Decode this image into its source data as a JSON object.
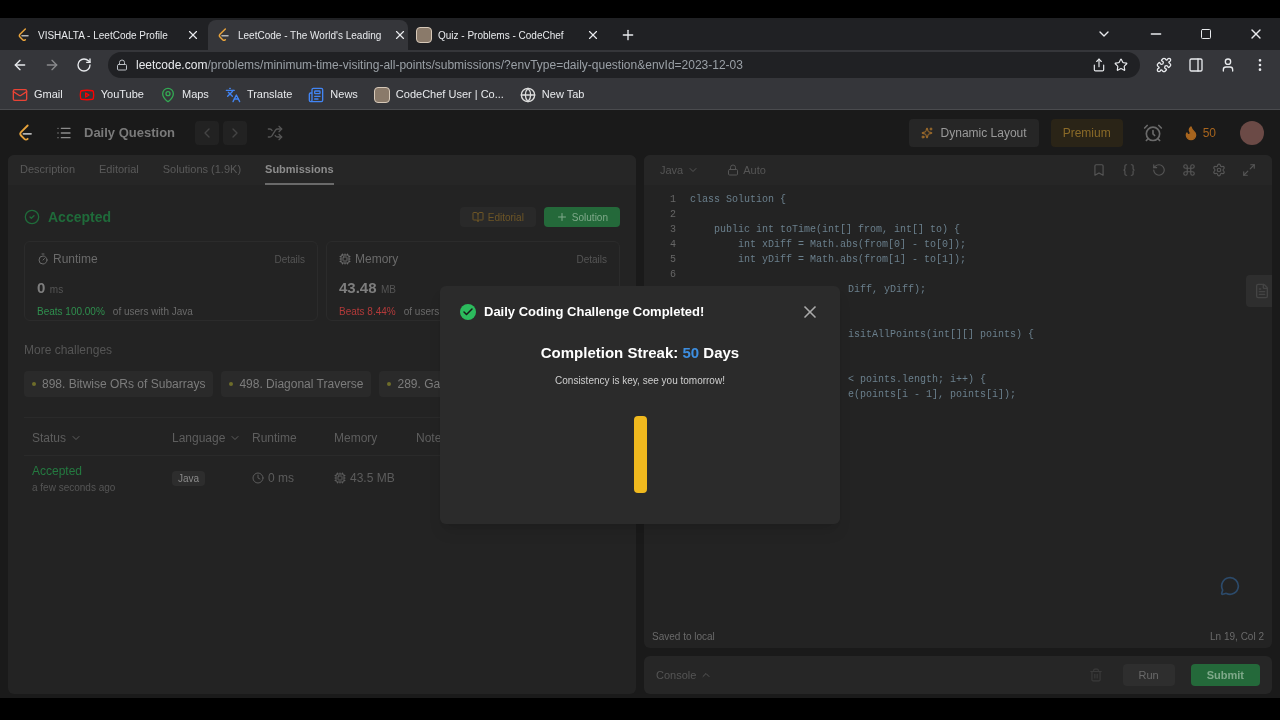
{
  "browser": {
    "tabs": [
      {
        "title": "VISHALTA - LeetCode Profile",
        "selected": false
      },
      {
        "title": "LeetCode - The World's Leading",
        "selected": true
      },
      {
        "title": "Quiz - Problems - CodeChef",
        "selected": false
      }
    ],
    "url_host": "leetcode.com",
    "url_path": "/problems/minimum-time-visiting-all-points/submissions/?envType=daily-question&envId=2023-12-03",
    "bookmarks": [
      {
        "label": "Gmail"
      },
      {
        "label": "YouTube"
      },
      {
        "label": "Maps"
      },
      {
        "label": "Translate"
      },
      {
        "label": "News"
      },
      {
        "label": "CodeChef User | Co..."
      },
      {
        "label": "New Tab"
      }
    ]
  },
  "header": {
    "title": "Daily Question",
    "layout_button": "Dynamic Layout",
    "premium_button": "Premium",
    "streak": "50"
  },
  "left_tabs": [
    {
      "label": "Description",
      "selected": false
    },
    {
      "label": "Editorial",
      "selected": false
    },
    {
      "label": "Solutions (1.9K)",
      "selected": false
    },
    {
      "label": "Submissions",
      "selected": true
    }
  ],
  "result": {
    "status": "Accepted",
    "editorial_button": "Editorial",
    "solution_button": "Solution"
  },
  "stats": [
    {
      "kind": "runtime",
      "label": "Runtime",
      "details": "Details",
      "value": "0",
      "unit": "ms",
      "beats": "Beats 100.00%",
      "color": "#2f8f4e",
      "note": "of users with Java"
    },
    {
      "kind": "memory",
      "label": "Memory",
      "details": "Details",
      "value": "43.48",
      "unit": "MB",
      "beats": "Beats 8.44%",
      "color": "#b33a3a",
      "note": "of users"
    }
  ],
  "more_challenges": {
    "title": "More challenges",
    "items": [
      "898. Bitwise ORs of Subarrays",
      "498. Diagonal Traverse",
      "289. Ga"
    ]
  },
  "table": {
    "columns": [
      {
        "label": "Status",
        "sortable": true
      },
      {
        "label": "Language",
        "sortable": true
      },
      {
        "label": "Runtime",
        "sortable": false
      },
      {
        "label": "Memory",
        "sortable": false
      },
      {
        "label": "Note"
      }
    ],
    "rows": [
      {
        "status": "Accepted",
        "time": "a few seconds ago",
        "language": "Java",
        "runtime": "0 ms",
        "memory": "43.5 MB"
      }
    ]
  },
  "editor": {
    "language": "Java",
    "mode": "Auto",
    "lines": [
      {
        "kind": "full",
        "number": "1",
        "text": "class Solution {"
      },
      {
        "kind": "full",
        "number": "2"
      },
      {
        "kind": "full",
        "number": "3",
        "text": "    public int toTime(int[] from, int[] to) {"
      },
      {
        "kind": "full",
        "number": "4",
        "text": "        int xDiff = Math.abs(from[0] - to[0]);"
      },
      {
        "kind": "full",
        "number": "5",
        "text": "        int yDiff = Math.abs(from[1] - to[1]);"
      },
      {
        "kind": "full",
        "number": "6"
      },
      {
        "kind": "partial",
        "text": "Diff, yDiff);"
      },
      {
        "kind": "covered"
      },
      {
        "kind": "covered"
      },
      {
        "kind": "partial",
        "text": "isitAllPoints(int[][] points) {"
      },
      {
        "kind": "covered"
      },
      {
        "kind": "covered"
      },
      {
        "kind": "partial",
        "text": "< points.length; i++) {"
      },
      {
        "kind": "partial",
        "text": "e(points[i - 1], points[i]);"
      }
    ],
    "saved": "Saved to local",
    "position": "Ln 19, Col 2",
    "console": "Console",
    "run": "Run",
    "submit": "Submit"
  },
  "modal": {
    "title": "Daily Coding Challenge Completed!",
    "streak_label": "Completion Streak:",
    "streak": "50",
    "streak_unit": "Days",
    "message": "Consistency is key, see you tomorrow!"
  }
}
